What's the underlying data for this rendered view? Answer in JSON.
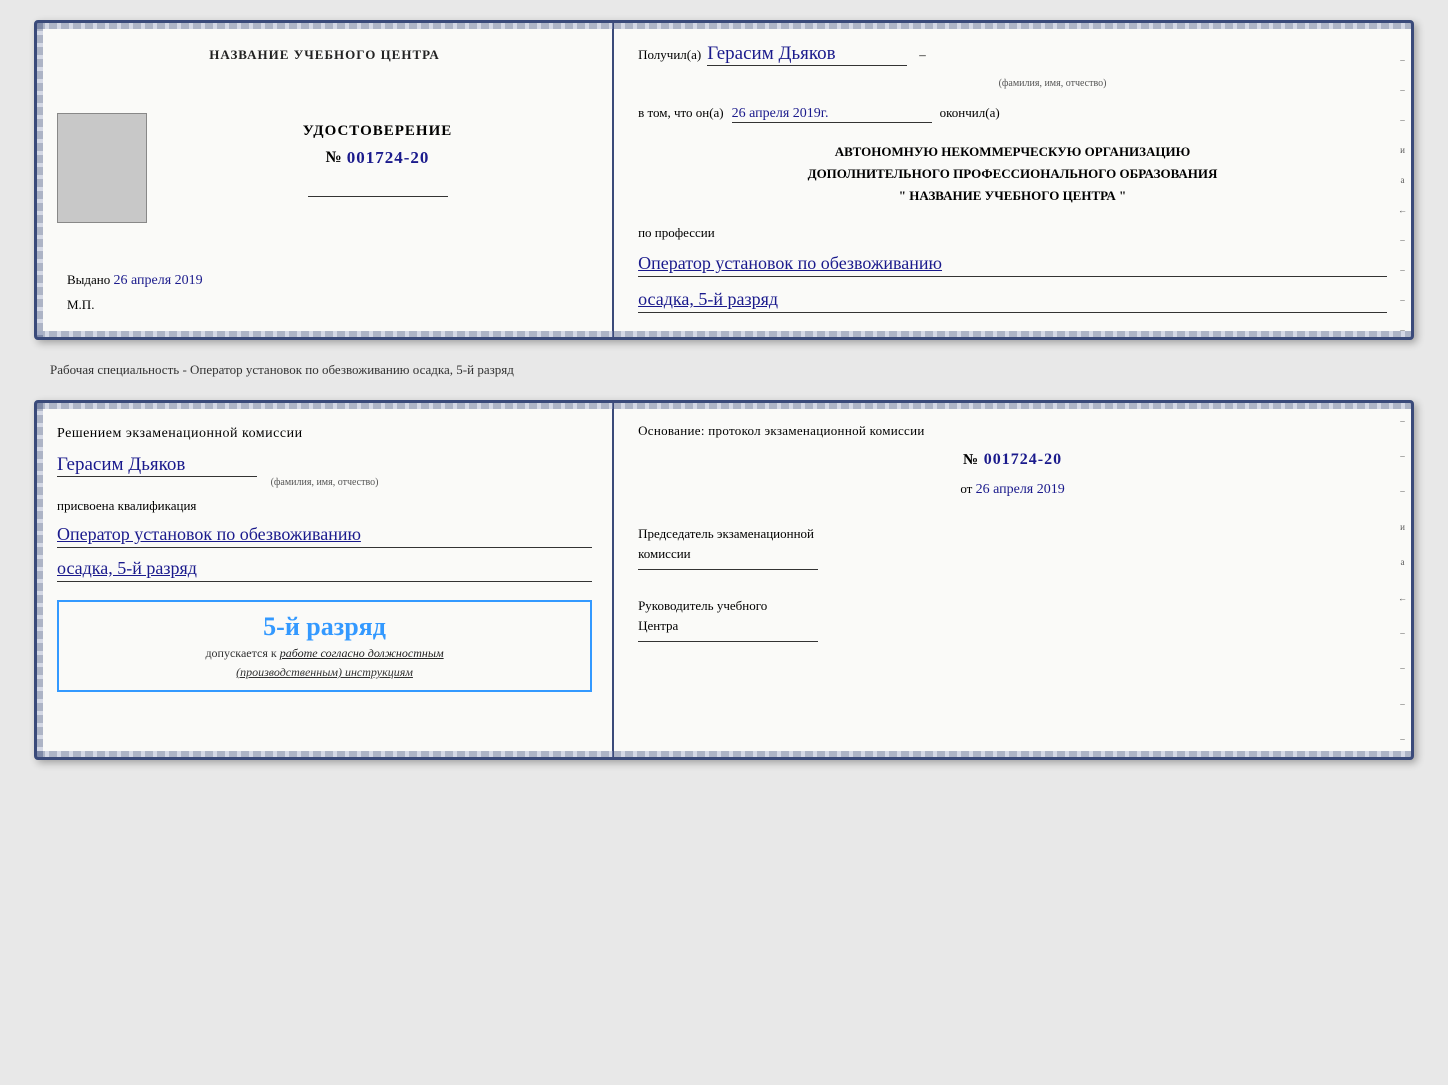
{
  "card1": {
    "left": {
      "org_name": "НАЗВАНИЕ УЧЕБНОГО ЦЕНТРА",
      "cert_title": "УДОСТОВЕРЕНИЕ",
      "cert_number_prefix": "№",
      "cert_number": "001724-20",
      "vydano_label": "Выдано",
      "vydano_date": "26 апреля 2019",
      "mp_label": "М.П."
    },
    "right": {
      "poluchil_label": "Получил(а)",
      "recipient_name": "Герасим Дьяков",
      "fio_sublabel": "(фамилия, имя, отчество)",
      "dash": "–",
      "vtom_label": "в том, что он(а)",
      "date_value": "26 апреля 2019г.",
      "okончил_label": "окончил(а)",
      "org_line1": "АВТОНОМНУЮ НЕКОММЕРЧЕСКУЮ ОРГАНИЗАЦИЮ",
      "org_line2": "ДОПОЛНИТЕЛЬНОГО ПРОФЕССИОНАЛЬНОГО ОБРАЗОВАНИЯ",
      "org_line3": "\" НАЗВАНИЕ УЧЕБНОГО ЦЕНТРА \"",
      "po_professii_label": "по профессии",
      "profession_line1": "Оператор установок по обезвоживанию",
      "profession_line2": "осадка, 5-й разряд"
    }
  },
  "separator": {
    "text": "Рабочая специальность - Оператор установок по обезвоживанию осадка, 5-й разряд"
  },
  "card2": {
    "left": {
      "resheniem_label": "Решением экзаменационной комиссии",
      "recipient_name": "Герасим Дьяков",
      "fio_sublabel": "(фамилия, имя, отчество)",
      "prisvoena_label": "присвоена квалификация",
      "qualification_line1": "Оператор установок по обезвоживанию",
      "qualification_line2": "осадка, 5-й разряд",
      "stamp_title": "5-й разряд",
      "stamp_sub1": "допускается к",
      "stamp_sub2": "работе согласно должностным",
      "stamp_sub3": "(производственным) инструкциям"
    },
    "right": {
      "osnovanie_label": "Основание: протокол экзаменационной комиссии",
      "number_prefix": "№",
      "number_value": "001724-20",
      "ot_label": "от",
      "ot_date": "26 апреля 2019",
      "predsedatel_line1": "Председатель экзаменационной",
      "predsedatel_line2": "комиссии",
      "rukovoditel_line1": "Руководитель учебного",
      "rukovoditel_line2": "Центра"
    }
  },
  "side_markers": {
    "right1": "–",
    "right2": "–",
    "right3": "–",
    "right4": "и",
    "right5": "а",
    "right6": "←",
    "right7": "–",
    "right8": "–",
    "right9": "–",
    "right10": "–"
  }
}
